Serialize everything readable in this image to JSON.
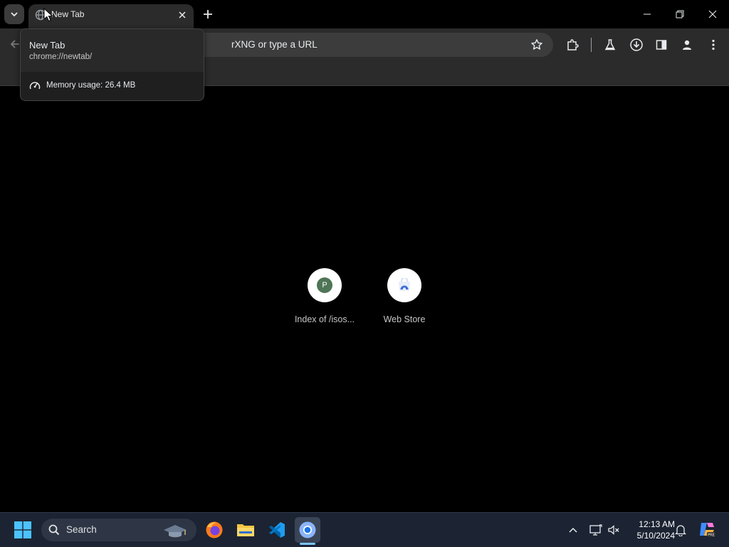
{
  "browser": {
    "tab": {
      "title": "New Tab"
    },
    "omnibox": {
      "placeholder_visible": "rXNG or type a URL"
    },
    "hover_card": {
      "title": "New Tab",
      "url": "chrome://newtab/",
      "memory": "Memory usage: 26.4 MB"
    }
  },
  "new_tab_page": {
    "shortcuts": [
      {
        "label": "Index of /isos...",
        "icon_letter": "P"
      },
      {
        "label": "Web Store"
      }
    ]
  },
  "taskbar": {
    "search_label": "Search",
    "clock": {
      "time": "12:13 AM",
      "date": "5/10/2024"
    }
  },
  "colors": {
    "page_bg": "#000000",
    "toolbar_bg": "#2b2b2b",
    "omnibox_bg": "#3c3c3c",
    "taskbar_bg": "#1c2433",
    "shortcut_letter_bg": "#4e7556"
  }
}
